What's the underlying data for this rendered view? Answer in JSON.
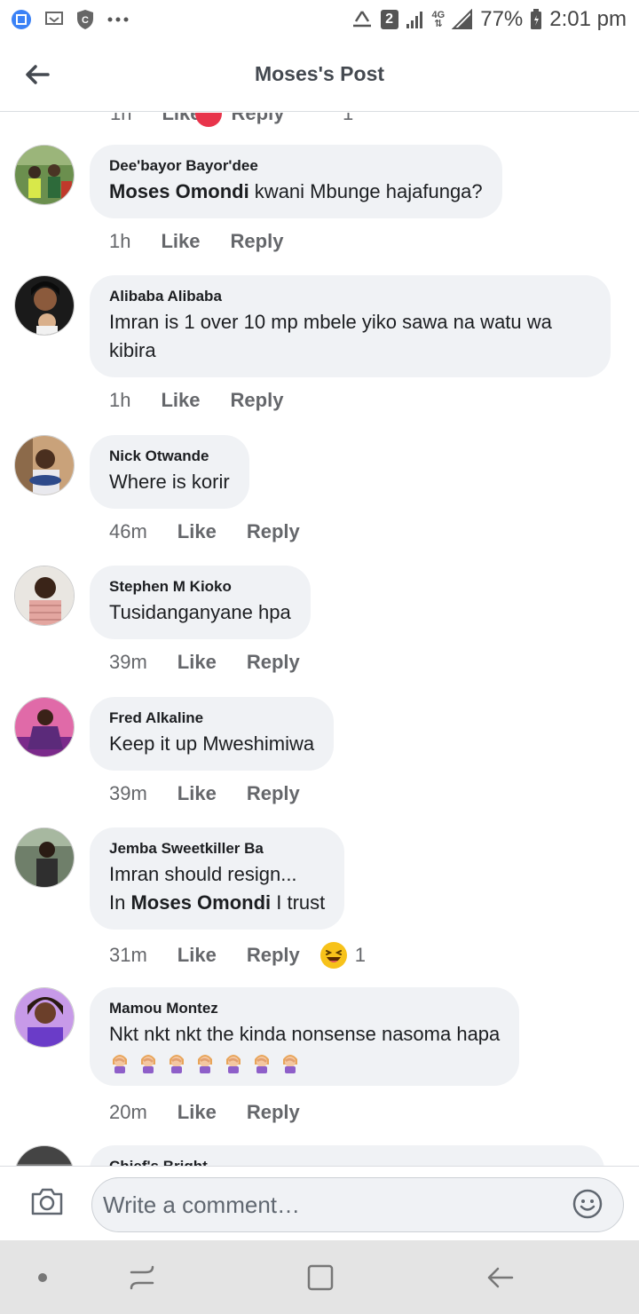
{
  "status_bar": {
    "badge": "2",
    "network": "4G",
    "battery": "77%",
    "time": "2:01 pm",
    "icons": [
      "screenshot-icon",
      "cast-icon",
      "shield-icon",
      "more-dots-icon",
      "recycle-icon",
      "signal-icon",
      "battery-icon"
    ]
  },
  "header": {
    "title": "Moses's Post",
    "back_icon": "arrow-left-icon"
  },
  "partial_top": {
    "time": "1h",
    "like": "Like",
    "reply": "Reply",
    "count": "1"
  },
  "comments": [
    {
      "author": "Dee'bayor Bayor'dee",
      "mention": "Moses Omondi",
      "text": " kwani Mbunge hajafunga?",
      "time": "1h",
      "like": "Like",
      "reply": "Reply"
    },
    {
      "author": "Alibaba Alibaba",
      "text": "Imran is 1 over 10 mp mbele yiko sawa na watu wa kibira",
      "time": "1h",
      "like": "Like",
      "reply": "Reply"
    },
    {
      "author": "Nick Otwande",
      "text": "Where is korir",
      "time": "46m",
      "like": "Like",
      "reply": "Reply"
    },
    {
      "author": "Stephen M Kioko",
      "text": "Tusidanganyane hpa",
      "time": "39m",
      "like": "Like",
      "reply": "Reply"
    },
    {
      "author": "Fred Alkaline",
      "text": "Keep it up Mweshimiwa",
      "time": "39m",
      "like": "Like",
      "reply": "Reply"
    },
    {
      "author": "Jemba Sweetkiller Ba",
      "line1": "Imran should resign...",
      "line2_prefix": "In ",
      "mention": "Moses Omondi",
      "line2_suffix": " I trust",
      "time": "31m",
      "like": "Like",
      "reply": "Reply",
      "reaction_count": "1",
      "reaction_icon": "laughing-emoji-icon"
    },
    {
      "author": "Mamou Montez",
      "text": "Nkt nkt nkt the kinda nonsense nasoma hapa",
      "emoji_icon": "facepalm-emoji-icon",
      "emoji_count": 7,
      "time": "20m",
      "like": "Like",
      "reply": "Reply"
    }
  ],
  "partial_bottom": {
    "author": "Chief's Bright"
  },
  "composer": {
    "placeholder": "Write a comment…",
    "camera_icon": "camera-icon",
    "emoji_icon": "smiley-icon"
  },
  "nav": {
    "icons": [
      "dot-icon",
      "recents-icon",
      "home-square-icon",
      "back-arrow-icon"
    ]
  },
  "colors": {
    "bubble": "#f0f2f5",
    "meta_text": "#65676b",
    "reaction_red": "#e8344b",
    "nav_bg": "#e4e4e4"
  }
}
